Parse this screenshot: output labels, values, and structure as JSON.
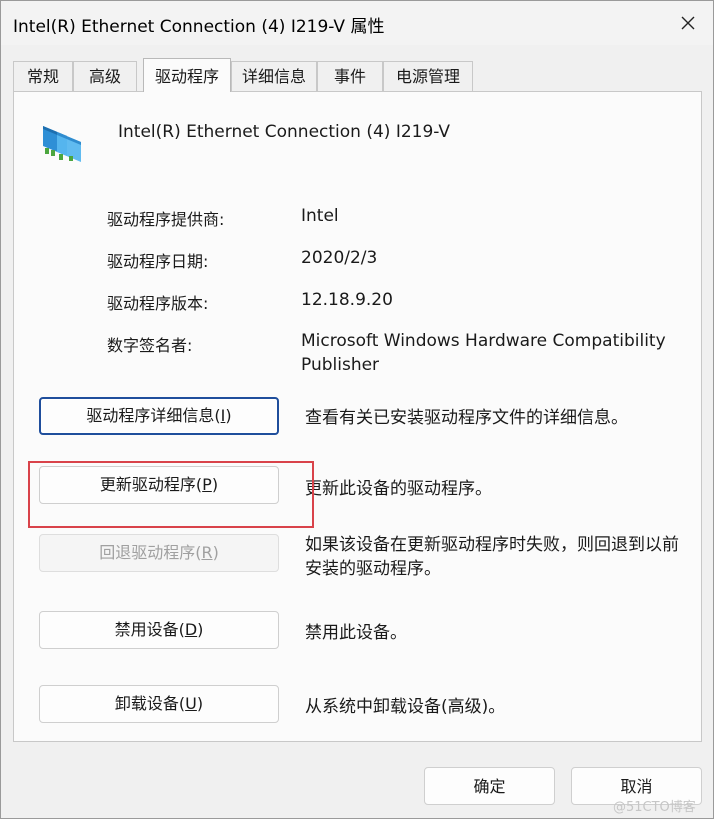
{
  "window": {
    "title": "Intel(R) Ethernet Connection (4) I219-V 属性"
  },
  "tabs": [
    {
      "label": "常规"
    },
    {
      "label": "高级"
    },
    {
      "label": "驱动程序",
      "active": true
    },
    {
      "label": "详细信息"
    },
    {
      "label": "事件"
    },
    {
      "label": "电源管理"
    }
  ],
  "device": {
    "name": "Intel(R) Ethernet Connection (4) I219-V",
    "icon": "network-adapter-icon"
  },
  "info": {
    "provider": {
      "label": "驱动程序提供商:",
      "value": "Intel"
    },
    "date": {
      "label": "驱动程序日期:",
      "value": "2020/2/3"
    },
    "version": {
      "label": "驱动程序版本:",
      "value": "12.18.9.20"
    },
    "signer": {
      "label": "数字签名者:",
      "value": "Microsoft Windows Hardware Compatibility Publisher"
    }
  },
  "actions": {
    "details": {
      "pre": "驱动程序详细信息(",
      "key": "I",
      "post": ")",
      "desc": "查看有关已安装驱动程序文件的详细信息。"
    },
    "update": {
      "pre": "更新驱动程序(",
      "key": "P",
      "post": ")",
      "desc": "更新此设备的驱动程序。"
    },
    "rollback": {
      "pre": "回退驱动程序(",
      "key": "R",
      "post": ")",
      "desc": "如果该设备在更新驱动程序时失败，则回退到以前安装的驱动程序。",
      "enabled": false
    },
    "disable": {
      "pre": "禁用设备(",
      "key": "D",
      "post": ")",
      "desc": "禁用此设备。"
    },
    "uninstall": {
      "pre": "卸载设备(",
      "key": "U",
      "post": ")",
      "desc": "从系统中卸载设备(高级)。"
    }
  },
  "footer": {
    "ok": "确定",
    "cancel": "取消"
  },
  "watermark": "@51CTO博客",
  "colors": {
    "highlight": "#d9434a",
    "focus": "#1f4e9c"
  }
}
